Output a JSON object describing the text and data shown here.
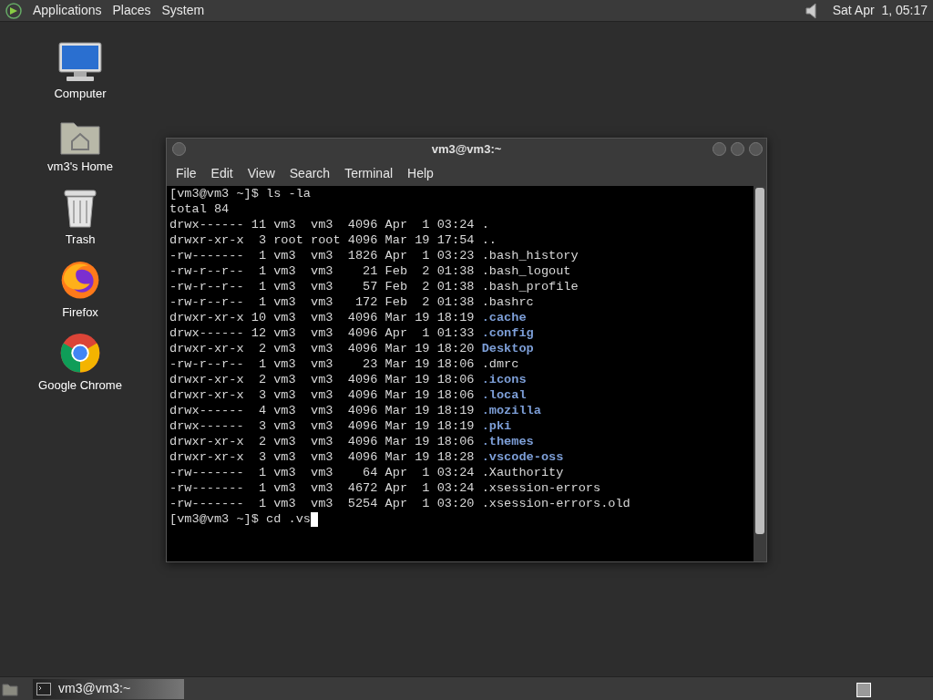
{
  "top_panel": {
    "menus": [
      "Applications",
      "Places",
      "System"
    ],
    "clock": "Sat Apr  1, 05:17"
  },
  "desktop_icons": [
    {
      "kind": "computer",
      "label": "Computer"
    },
    {
      "kind": "home",
      "label": "vm3's Home"
    },
    {
      "kind": "trash",
      "label": "Trash"
    },
    {
      "kind": "firefox",
      "label": "Firefox"
    },
    {
      "kind": "chrome",
      "label": "Google Chrome"
    }
  ],
  "window": {
    "title": "vm3@vm3:~",
    "menu": [
      "File",
      "Edit",
      "View",
      "Search",
      "Terminal",
      "Help"
    ],
    "lines": [
      {
        "text": "[vm3@vm3 ~]$ ls -la"
      },
      {
        "text": "total 84"
      },
      {
        "text": "drwx------ 11 vm3  vm3  4096 Apr  1 03:24 ",
        "name": ".",
        "kind": "file"
      },
      {
        "text": "drwxr-xr-x  3 root root 4096 Mar 19 17:54 ",
        "name": "..",
        "kind": "file"
      },
      {
        "text": "-rw-------  1 vm3  vm3  1826 Apr  1 03:23 ",
        "name": ".bash_history",
        "kind": "file"
      },
      {
        "text": "-rw-r--r--  1 vm3  vm3    21 Feb  2 01:38 ",
        "name": ".bash_logout",
        "kind": "file"
      },
      {
        "text": "-rw-r--r--  1 vm3  vm3    57 Feb  2 01:38 ",
        "name": ".bash_profile",
        "kind": "file"
      },
      {
        "text": "-rw-r--r--  1 vm3  vm3   172 Feb  2 01:38 ",
        "name": ".bashrc",
        "kind": "file"
      },
      {
        "text": "drwxr-xr-x 10 vm3  vm3  4096 Mar 19 18:19 ",
        "name": ".cache",
        "kind": "dir"
      },
      {
        "text": "drwx------ 12 vm3  vm3  4096 Apr  1 01:33 ",
        "name": ".config",
        "kind": "dir"
      },
      {
        "text": "drwxr-xr-x  2 vm3  vm3  4096 Mar 19 18:20 ",
        "name": "Desktop",
        "kind": "dir"
      },
      {
        "text": "-rw-r--r--  1 vm3  vm3    23 Mar 19 18:06 ",
        "name": ".dmrc",
        "kind": "file"
      },
      {
        "text": "drwxr-xr-x  2 vm3  vm3  4096 Mar 19 18:06 ",
        "name": ".icons",
        "kind": "dir"
      },
      {
        "text": "drwxr-xr-x  3 vm3  vm3  4096 Mar 19 18:06 ",
        "name": ".local",
        "kind": "dir"
      },
      {
        "text": "drwx------  4 vm3  vm3  4096 Mar 19 18:19 ",
        "name": ".mozilla",
        "kind": "dir"
      },
      {
        "text": "drwx------  3 vm3  vm3  4096 Mar 19 18:19 ",
        "name": ".pki",
        "kind": "dir"
      },
      {
        "text": "drwxr-xr-x  2 vm3  vm3  4096 Mar 19 18:06 ",
        "name": ".themes",
        "kind": "dir"
      },
      {
        "text": "drwxr-xr-x  3 vm3  vm3  4096 Mar 19 18:28 ",
        "name": ".vscode-oss",
        "kind": "dir"
      },
      {
        "text": "-rw-------  1 vm3  vm3    64 Apr  1 03:24 ",
        "name": ".Xauthority",
        "kind": "file"
      },
      {
        "text": "-rw-------  1 vm3  vm3  4672 Apr  1 03:24 ",
        "name": ".xsession-errors",
        "kind": "file"
      },
      {
        "text": "-rw-------  1 vm3  vm3  5254 Apr  1 03:20 ",
        "name": ".xsession-errors.old",
        "kind": "file"
      }
    ],
    "prompt": "[vm3@vm3 ~]$ cd .vs"
  },
  "taskbar": {
    "tasks": [
      {
        "label": "vm3@vm3:~",
        "selected": true
      }
    ]
  }
}
